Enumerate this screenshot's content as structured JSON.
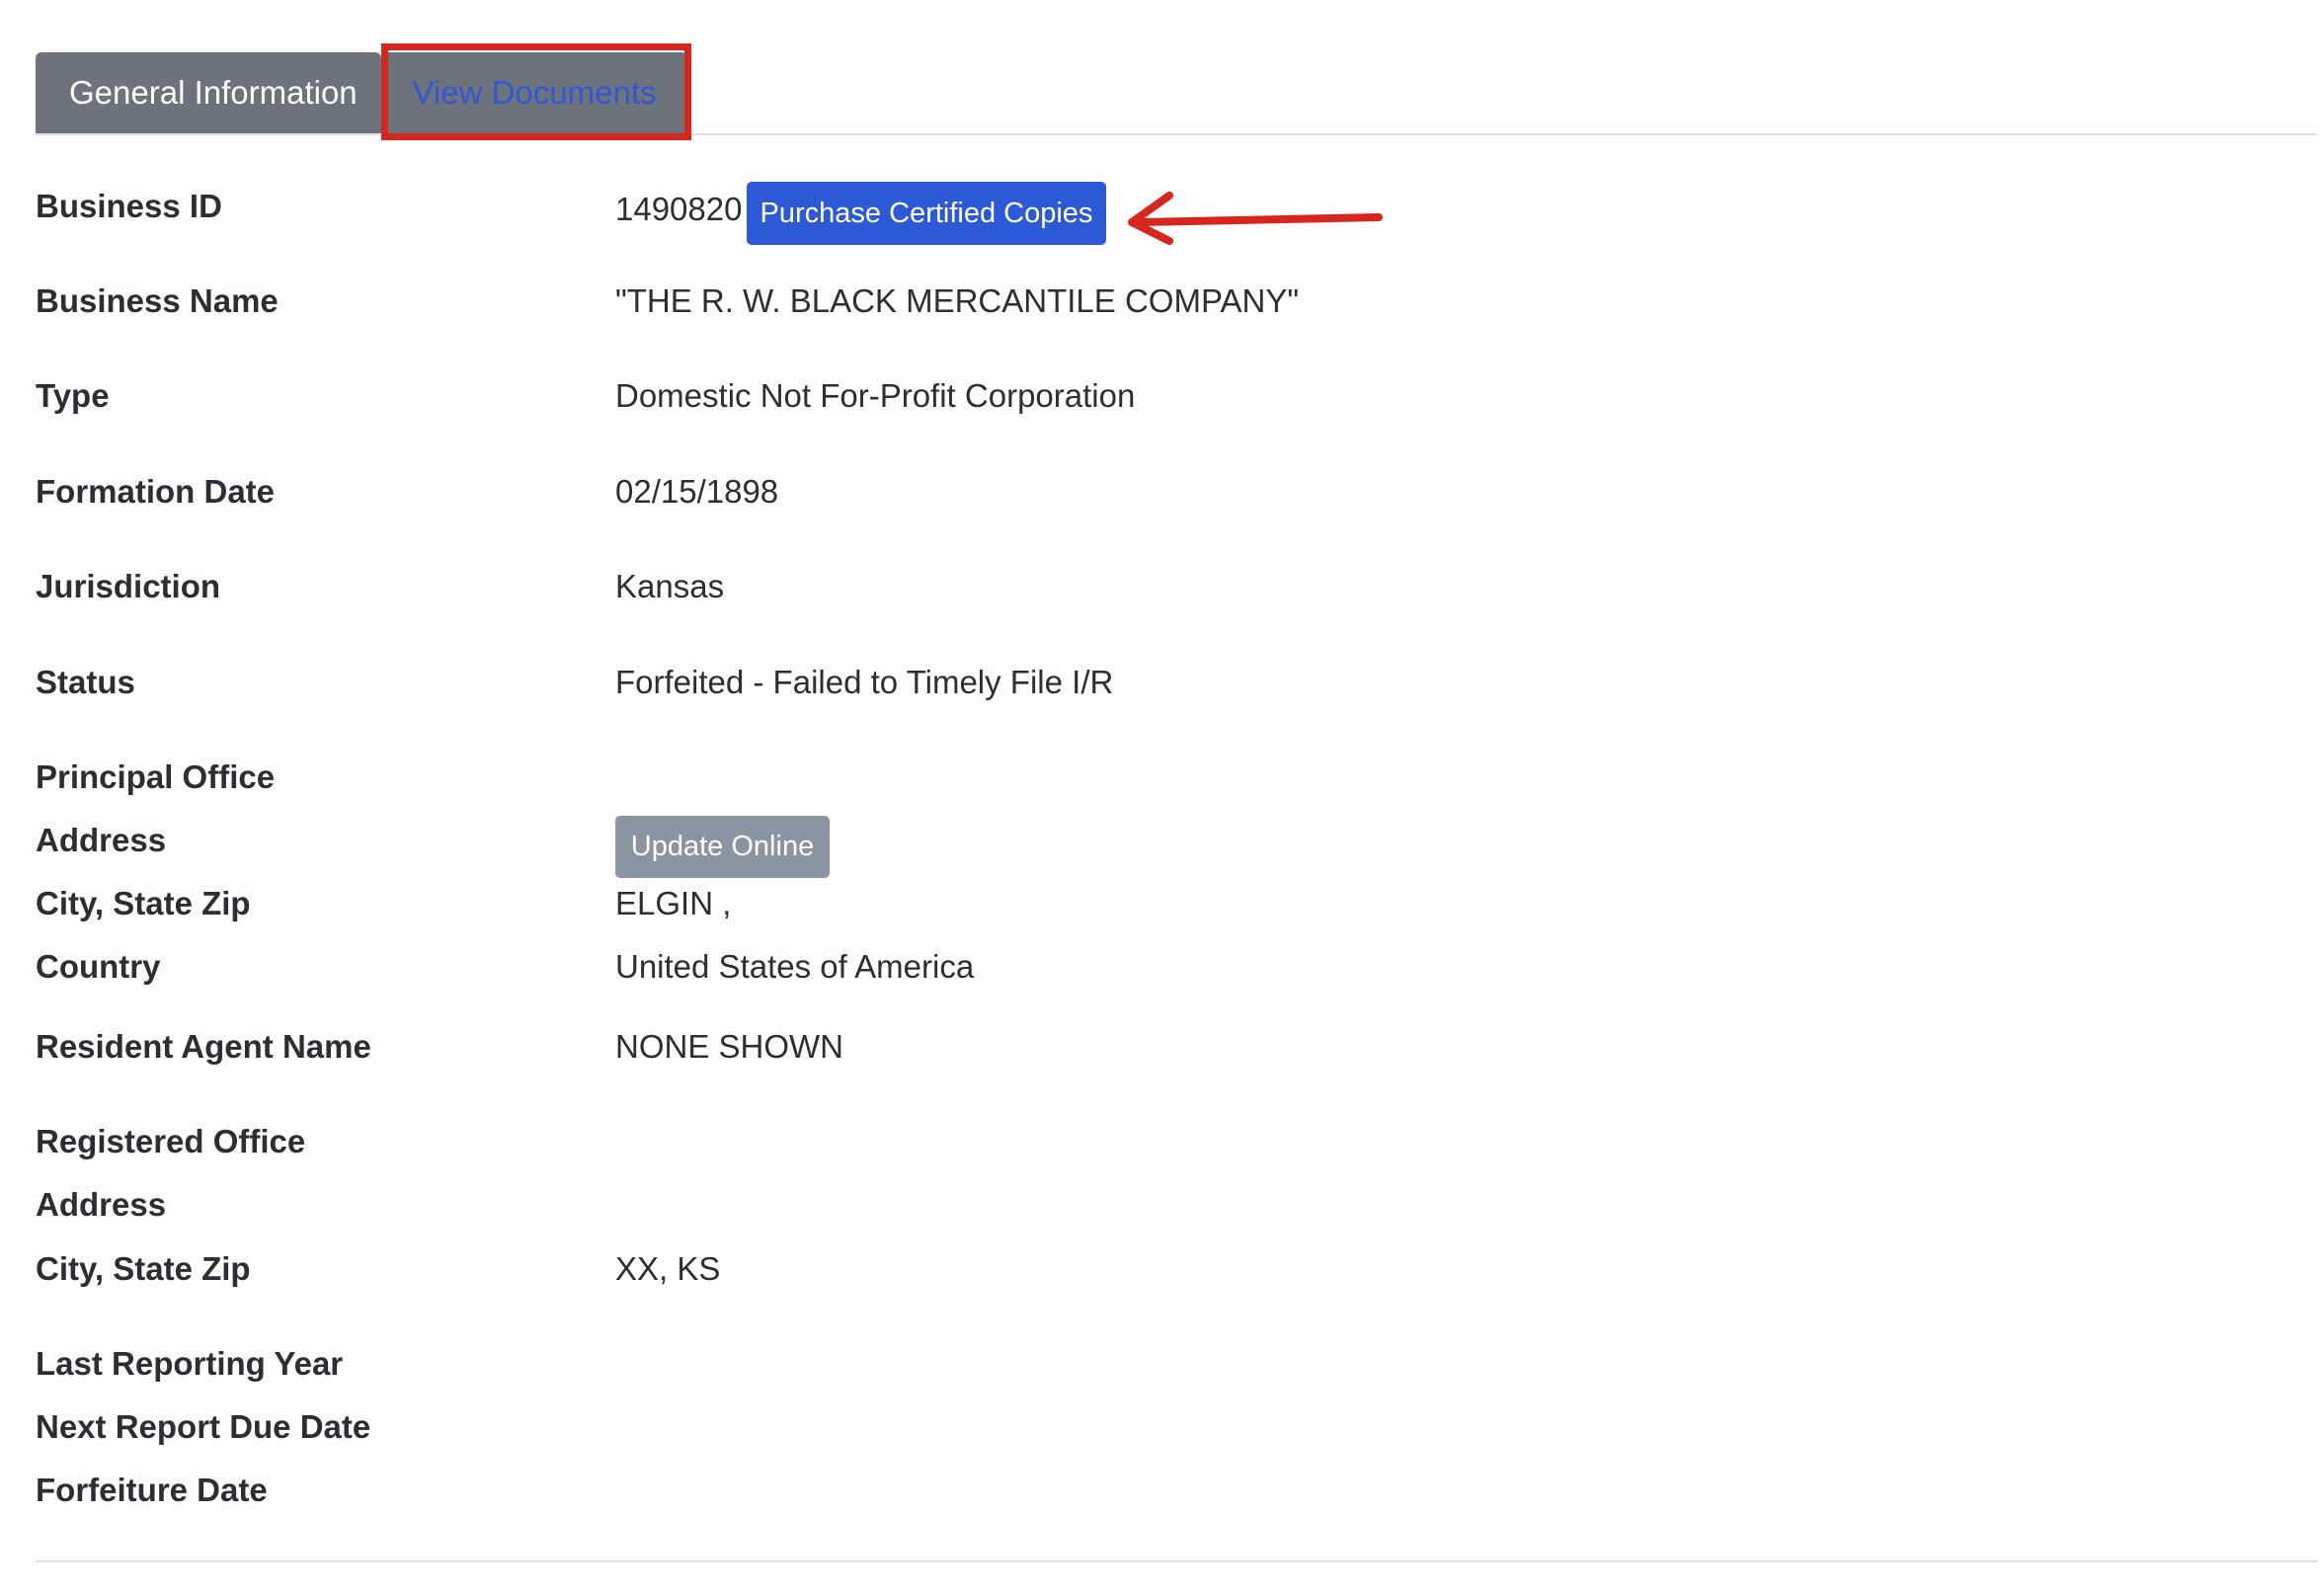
{
  "tabs": {
    "general": "General Information",
    "documents": "View Documents"
  },
  "business": {
    "id_label": "Business ID",
    "id_value": "1490820",
    "purchase_button": "Purchase Certified Copies",
    "name_label": "Business Name",
    "name_value": "\"THE R. W. BLACK MERCANTILE COMPANY\"",
    "type_label": "Type",
    "type_value": "Domestic Not For-Profit Corporation",
    "formation_label": "Formation Date",
    "formation_value": "02/15/1898",
    "jurisdiction_label": "Jurisdiction",
    "jurisdiction_value": "Kansas",
    "status_label": "Status",
    "status_value": "Forfeited - Failed to Timely File I/R"
  },
  "principal_office": {
    "heading": "Principal Office",
    "address_label": "Address",
    "update_button": "Update Online",
    "city_label": "City, State Zip",
    "city_value": "ELGIN ,",
    "country_label": "Country",
    "country_value": "United States of America"
  },
  "resident_agent": {
    "label": "Resident Agent Name",
    "value": "NONE SHOWN"
  },
  "registered_office": {
    "heading": "Registered Office",
    "address_label": "Address",
    "city_label": "City, State Zip",
    "city_value": "XX, KS"
  },
  "reporting": {
    "last_year_label": "Last Reporting Year",
    "next_due_label": "Next Report Due Date",
    "forfeiture_label": "Forfeiture Date"
  },
  "colors": {
    "annotation": "#d7261e",
    "primary_button": "#2c59d6",
    "tab_background": "#6c737b"
  }
}
